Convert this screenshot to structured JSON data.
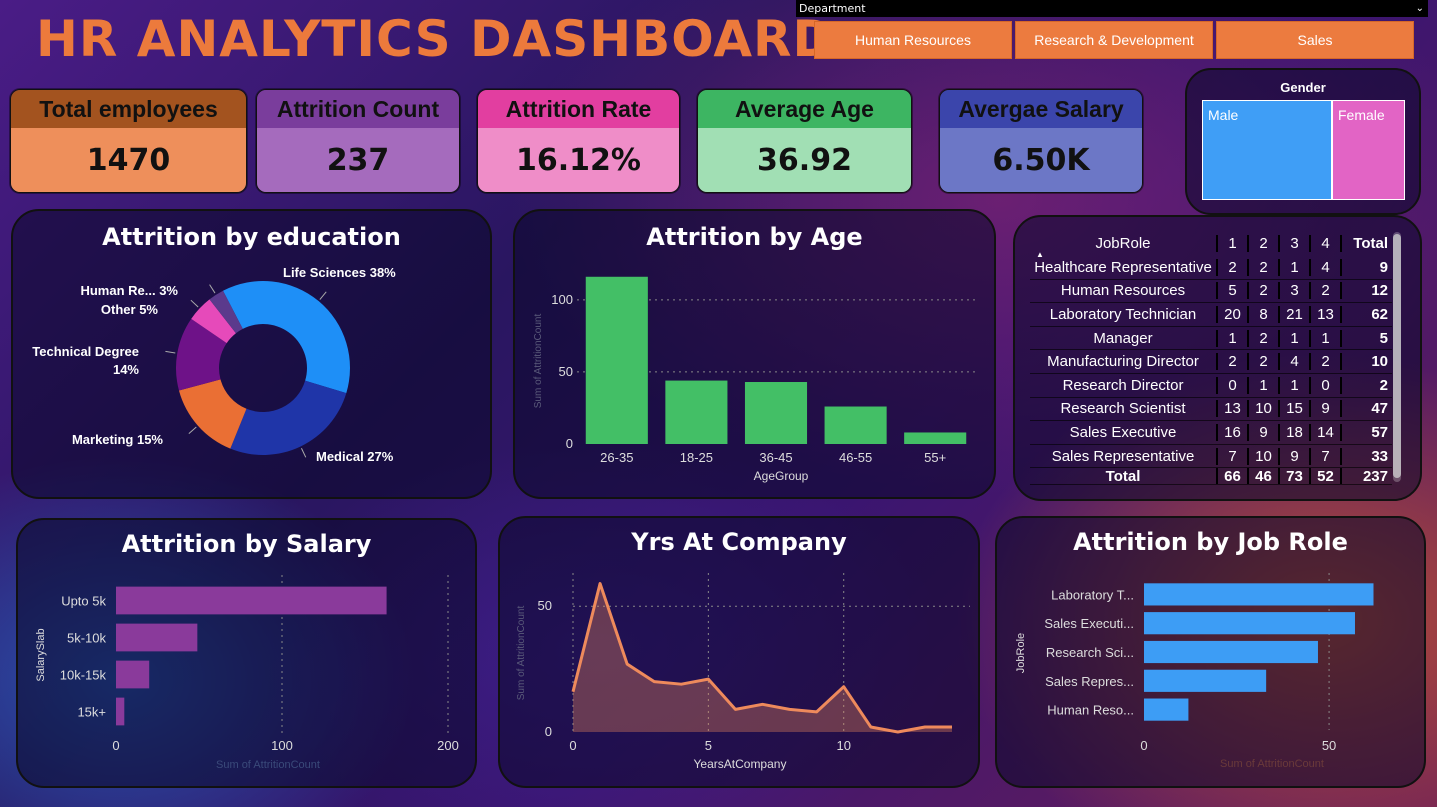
{
  "title": "HR ANALYTICS DASHBOARD",
  "slicer": {
    "label": "Department",
    "options": [
      "Human Resources",
      "Research & Development",
      "Sales"
    ]
  },
  "kpis": [
    {
      "label": "Total employees",
      "value": "1470",
      "head": "#a3531f",
      "body": "#ee8f5b"
    },
    {
      "label": "Attrition Count",
      "value": "237",
      "head": "#7a3d9c",
      "body": "#a56bbd"
    },
    {
      "label": "Attrition Rate",
      "value": "16.12%",
      "head": "#e23ea0",
      "body": "#ef8dc8"
    },
    {
      "label": "Average Age",
      "value": "36.92",
      "head": "#3db562",
      "body": "#a1dfb4"
    },
    {
      "label": "Avergae Salary",
      "value": "6.50K",
      "head": "#3b45ab",
      "body": "#6c77c6"
    }
  ],
  "gender": {
    "title": "Gender",
    "items": [
      {
        "label": "Male",
        "color": "#3f9ef6"
      },
      {
        "label": "Female",
        "color": "#e264c5"
      }
    ]
  },
  "education": {
    "title": "Attrition by education",
    "chart_data": {
      "type": "pie",
      "donut": true,
      "slices": [
        {
          "label": "Life Sciences",
          "pct": 38,
          "text": "Life Sciences 38%",
          "color": "#1e8ff7"
        },
        {
          "label": "Medical",
          "pct": 27,
          "text": "Medical 27%",
          "color": "#1f35a8"
        },
        {
          "label": "Marketing",
          "pct": 15,
          "text": "Marketing 15%",
          "color": "#ea6f34"
        },
        {
          "label": "Technical Degree",
          "pct": 14,
          "text": "Technical Degree 14%",
          "text_lines": [
            "Technical Degree",
            "14%"
          ],
          "color": "#6e1288"
        },
        {
          "label": "Other",
          "pct": 5,
          "text": "Other 5%",
          "color": "#e64aba"
        },
        {
          "label": "Human Re...",
          "pct": 3,
          "text": "Human Re... 3%",
          "color": "#5b3a8c"
        }
      ]
    }
  },
  "age": {
    "title": "Attrition by Age",
    "chart_data": {
      "type": "bar",
      "categories": [
        "26-35",
        "18-25",
        "36-45",
        "46-55",
        "55+"
      ],
      "values": [
        116,
        44,
        43,
        26,
        8
      ],
      "xlabel": "AgeGroup",
      "ylabel": "Sum of AttritionCount",
      "yticks": [
        0,
        50,
        100
      ],
      "ylim": [
        0,
        120
      ],
      "color": "#43bf66"
    }
  },
  "matrix": {
    "columns": [
      "JobRole",
      "1",
      "2",
      "3",
      "4",
      "Total"
    ],
    "rows": [
      {
        "role": "Healthcare Representative",
        "v": [
          "2",
          "2",
          "1",
          "4"
        ],
        "total": "9"
      },
      {
        "role": "Human Resources",
        "v": [
          "5",
          "2",
          "3",
          "2"
        ],
        "total": "12"
      },
      {
        "role": "Laboratory Technician",
        "v": [
          "20",
          "8",
          "21",
          "13"
        ],
        "total": "62"
      },
      {
        "role": "Manager",
        "v": [
          "1",
          "2",
          "1",
          "1"
        ],
        "total": "5"
      },
      {
        "role": "Manufacturing Director",
        "v": [
          "2",
          "2",
          "4",
          "2"
        ],
        "total": "10"
      },
      {
        "role": "Research Director",
        "v": [
          "0",
          "1",
          "1",
          "0"
        ],
        "total": "2"
      },
      {
        "role": "Research Scientist",
        "v": [
          "13",
          "10",
          "15",
          "9"
        ],
        "total": "47"
      },
      {
        "role": "Sales Executive",
        "v": [
          "16",
          "9",
          "18",
          "14"
        ],
        "total": "57"
      },
      {
        "role": "Sales Representative",
        "v": [
          "7",
          "10",
          "9",
          "7"
        ],
        "total": "33"
      }
    ],
    "total": {
      "role": "Total",
      "v": [
        "66",
        "46",
        "73",
        "52"
      ],
      "total": "237"
    }
  },
  "salary": {
    "title": "Attrition by Salary",
    "chart_data": {
      "type": "bar",
      "orientation": "horizontal",
      "categories": [
        "Upto 5k",
        "5k-10k",
        "10k-15k",
        "15k+"
      ],
      "values": [
        163,
        49,
        20,
        5
      ],
      "xlabel": "Sum of AttritionCount",
      "ylabel": "SalarySlab",
      "xticks": [
        0,
        100,
        200
      ],
      "xlim": [
        0,
        200
      ],
      "color": "#8a3a9b"
    }
  },
  "years": {
    "title": "Yrs At Company",
    "chart_data": {
      "type": "area",
      "x": [
        0,
        1,
        2,
        3,
        4,
        5,
        6,
        7,
        8,
        9,
        10,
        11,
        12,
        13,
        14
      ],
      "values": [
        16,
        59,
        27,
        20,
        19,
        21,
        9,
        11,
        9,
        8,
        18,
        2,
        0,
        2,
        2
      ],
      "xlabel": "YearsAtCompany",
      "ylabel": "Sum of AttritionCount",
      "xticks": [
        0,
        5,
        10
      ],
      "yticks": [
        0,
        50
      ],
      "xlim": [
        0,
        14
      ],
      "ylim": [
        0,
        62
      ],
      "color": "#ee8a5c"
    }
  },
  "jobrole": {
    "title": "Attrition by Job Role",
    "chart_data": {
      "type": "bar",
      "orientation": "horizontal",
      "categories": [
        "Laboratory T...",
        "Sales Executi...",
        "Research Sci...",
        "Sales Repres...",
        "Human Reso..."
      ],
      "values": [
        62,
        57,
        47,
        33,
        12
      ],
      "xlabel": "Sum of AttritionCount",
      "ylabel": "JobRole",
      "xticks": [
        0,
        50
      ],
      "xlim": [
        0,
        67
      ],
      "color": "#3d9df5"
    }
  }
}
